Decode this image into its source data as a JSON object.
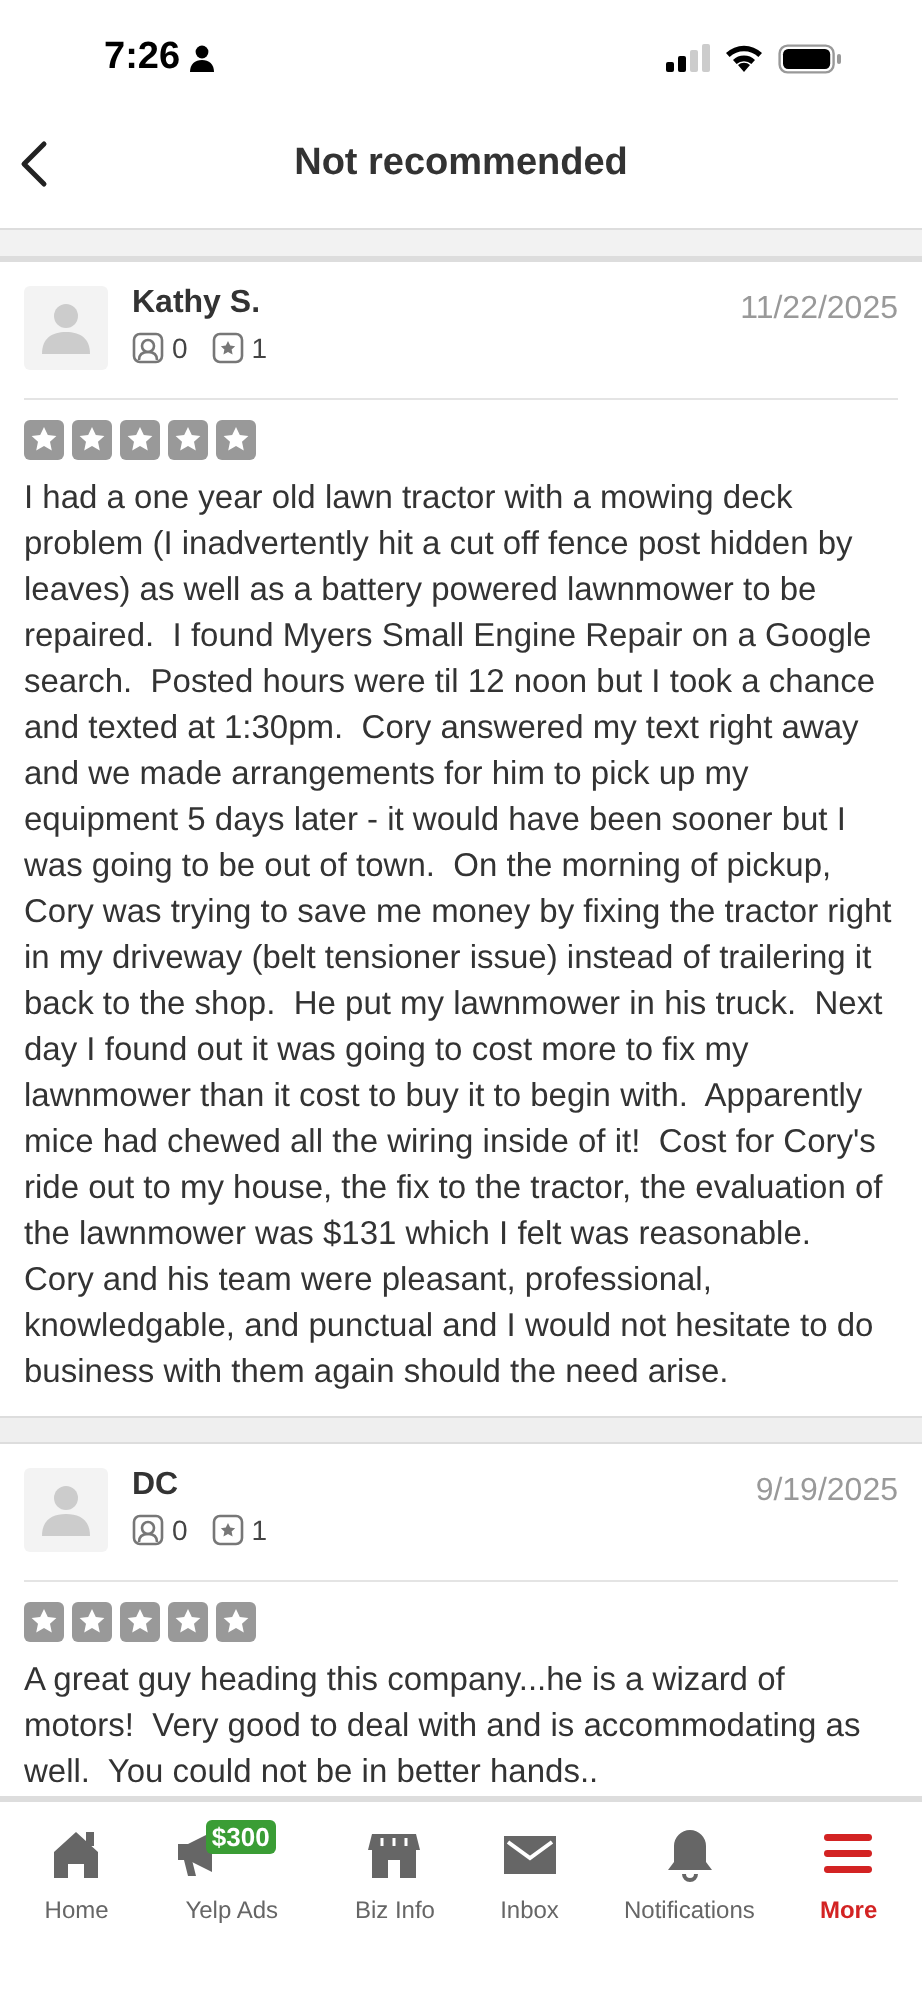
{
  "status_bar": {
    "time": "7:26"
  },
  "nav": {
    "title": "Not recommended"
  },
  "reviews": [
    {
      "name": "Kathy S.",
      "date": "11/22/2025",
      "friends": "0",
      "reviews_count": "1",
      "stars": 0,
      "text": "I had a one year old lawn tractor with a mowing deck problem (I inadvertently hit a cut off fence post hidden by leaves) as well as a battery powered lawnmower to be repaired.  I found Myers Small Engine Repair on a Google search.  Posted hours were til 12 noon but I took a chance and texted at 1:30pm.  Cory answered my text right away and we made arrangements for him to pick up my equipment 5 days later - it would have been sooner but I was going to be out of town.  On the morning of pickup, Cory was trying to save me money by fixing the tractor right in my driveway (belt tensioner issue) instead of trailering it back to the shop.  He put my lawnmower in his truck.  Next day I found out it was going to cost more to fix my lawnmower than it cost to buy it to begin with.  Apparently mice had chewed all the wiring inside of it!  Cost for Cory's ride out to my house, the fix to the tractor, the evaluation of the lawnmower was $131 which I felt was reasonable.  Cory and his team were pleasant, professional, knowledgable, and punctual and I would not hesitate to do business with them again should the need arise."
    },
    {
      "name": "DC",
      "date": "9/19/2025",
      "friends": "0",
      "reviews_count": "1",
      "stars": 0,
      "text": "A great guy heading this company...he is a wizard of motors!  Very good to deal with and is accommodating as well.  You could not be in better hands.."
    }
  ],
  "tab_bar": [
    {
      "kind": "home",
      "label": "Home",
      "selected": false
    },
    {
      "kind": "ads",
      "label": "Yelp Ads",
      "badge": "$300",
      "selected": false
    },
    {
      "kind": "biz",
      "label": "Biz Info",
      "selected": false
    },
    {
      "kind": "inbox",
      "label": "Inbox",
      "selected": false
    },
    {
      "kind": "bell",
      "label": "Notifications",
      "selected": false
    },
    {
      "kind": "more",
      "label": "More",
      "selected": true
    }
  ]
}
